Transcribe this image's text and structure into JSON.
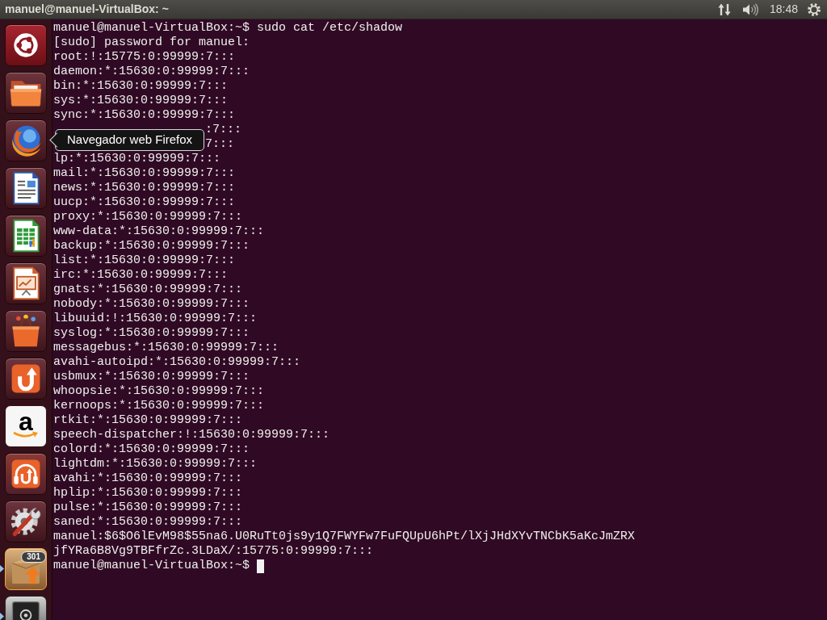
{
  "top_panel": {
    "title": "manuel@manuel-VirtualBox: ~",
    "clock": "18:48"
  },
  "launcher": {
    "items": [
      {
        "kind": "dash",
        "running": false
      },
      {
        "kind": "files",
        "running": false
      },
      {
        "kind": "browser",
        "running": false,
        "tooltip": "Navegador web Firefox"
      },
      {
        "kind": "writer",
        "running": false
      },
      {
        "kind": "calc",
        "running": false
      },
      {
        "kind": "impress",
        "running": false
      },
      {
        "kind": "store",
        "running": false
      },
      {
        "kind": "cloud",
        "running": false
      },
      {
        "kind": "shop",
        "glyph": "a",
        "running": false
      },
      {
        "kind": "music",
        "running": false
      },
      {
        "kind": "settings",
        "running": false
      },
      {
        "kind": "updates",
        "badge": "301",
        "running": true
      },
      {
        "kind": "safe",
        "running": true
      }
    ]
  },
  "terminal": {
    "lines": [
      {
        "kind": "output",
        "text": "manuel@manuel-VirtualBox:~$ sudo cat /etc/shadow"
      },
      {
        "kind": "output",
        "text": "[sudo] password for manuel:"
      },
      {
        "kind": "output",
        "text": "root:!:15775:0:99999:7:::"
      },
      {
        "kind": "output",
        "text": "daemon:*:15630:0:99999:7:::"
      },
      {
        "kind": "output",
        "text": "bin:*:15630:0:99999:7:::"
      },
      {
        "kind": "output",
        "text": "sys:*:15630:0:99999:7:::"
      },
      {
        "kind": "output",
        "text": "sync:*:15630:0:99999:7:::"
      },
      {
        "kind": "partial",
        "text": ":7:::"
      },
      {
        "kind": "partial",
        "text": "7:::"
      },
      {
        "kind": "output",
        "text": "lp:*:15630:0:99999:7:::"
      },
      {
        "kind": "output",
        "text": "mail:*:15630:0:99999:7:::"
      },
      {
        "kind": "output",
        "text": "news:*:15630:0:99999:7:::"
      },
      {
        "kind": "output",
        "text": "uucp:*:15630:0:99999:7:::"
      },
      {
        "kind": "output",
        "text": "proxy:*:15630:0:99999:7:::"
      },
      {
        "kind": "output",
        "text": "www-data:*:15630:0:99999:7:::"
      },
      {
        "kind": "output",
        "text": "backup:*:15630:0:99999:7:::"
      },
      {
        "kind": "output",
        "text": "list:*:15630:0:99999:7:::"
      },
      {
        "kind": "output",
        "text": "irc:*:15630:0:99999:7:::"
      },
      {
        "kind": "output",
        "text": "gnats:*:15630:0:99999:7:::"
      },
      {
        "kind": "output",
        "text": "nobody:*:15630:0:99999:7:::"
      },
      {
        "kind": "output",
        "text": "libuuid:!:15630:0:99999:7:::"
      },
      {
        "kind": "output",
        "text": "syslog:*:15630:0:99999:7:::"
      },
      {
        "kind": "output",
        "text": "messagebus:*:15630:0:99999:7:::"
      },
      {
        "kind": "output",
        "text": "avahi-autoipd:*:15630:0:99999:7:::"
      },
      {
        "kind": "output",
        "text": "usbmux:*:15630:0:99999:7:::"
      },
      {
        "kind": "output",
        "text": "whoopsie:*:15630:0:99999:7:::"
      },
      {
        "kind": "output",
        "text": "kernoops:*:15630:0:99999:7:::"
      },
      {
        "kind": "output",
        "text": "rtkit:*:15630:0:99999:7:::"
      },
      {
        "kind": "output",
        "text": "speech-dispatcher:!:15630:0:99999:7:::"
      },
      {
        "kind": "output",
        "text": "colord:*:15630:0:99999:7:::"
      },
      {
        "kind": "output",
        "text": "lightdm:*:15630:0:99999:7:::"
      },
      {
        "kind": "output",
        "text": "avahi:*:15630:0:99999:7:::"
      },
      {
        "kind": "output",
        "text": "hplip:*:15630:0:99999:7:::"
      },
      {
        "kind": "output",
        "text": "pulse:*:15630:0:99999:7:::"
      },
      {
        "kind": "output",
        "text": "saned:*:15630:0:99999:7:::"
      },
      {
        "kind": "output",
        "text": "manuel:$6$O6lEvM98$55na6.U0RuTt0js9y1Q7FWYFw7FuFQUpU6hPt/lXjJHdXYvTNCbK5aKcJmZRX"
      },
      {
        "kind": "output",
        "text": "jfYRa6B8Vg9TBFfrZc.3LDaX/:15775:0:99999:7:::"
      }
    ],
    "prompt": "manuel@manuel-VirtualBox:~$"
  }
}
